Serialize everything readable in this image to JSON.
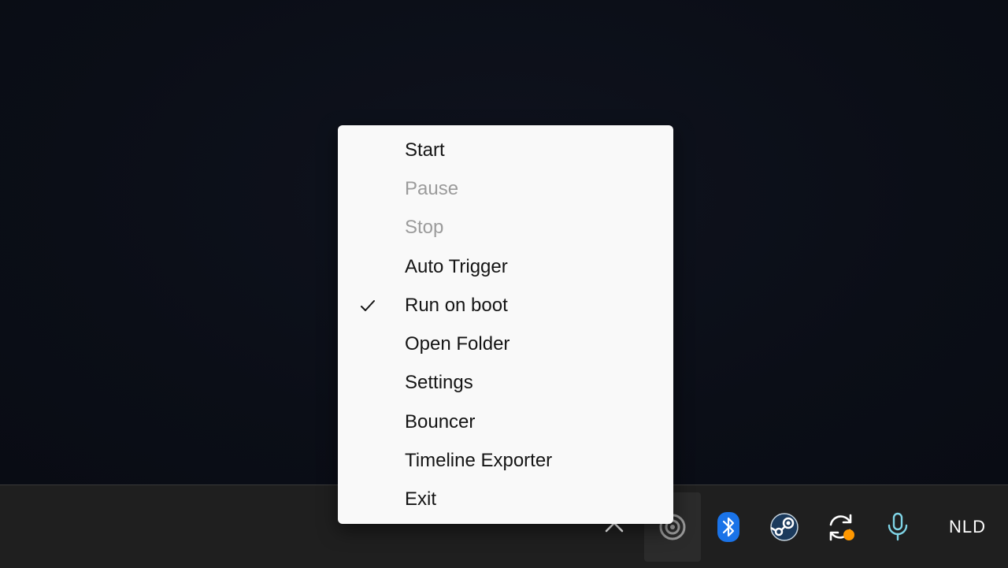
{
  "menu": {
    "items": [
      {
        "label": "Start",
        "enabled": true,
        "checked": false
      },
      {
        "label": "Pause",
        "enabled": false,
        "checked": false
      },
      {
        "label": "Stop",
        "enabled": false,
        "checked": false
      },
      {
        "label": "Auto Trigger",
        "enabled": true,
        "checked": false
      },
      {
        "label": "Run on boot",
        "enabled": true,
        "checked": true
      },
      {
        "label": "Open Folder",
        "enabled": true,
        "checked": false
      },
      {
        "label": "Settings",
        "enabled": true,
        "checked": false
      },
      {
        "label": "Bouncer",
        "enabled": true,
        "checked": false
      },
      {
        "label": "Timeline Exporter",
        "enabled": true,
        "checked": false
      },
      {
        "label": "Exit",
        "enabled": true,
        "checked": false
      }
    ]
  },
  "tray": {
    "icons": [
      {
        "name": "chevron-up-icon",
        "color": "#ffffff"
      },
      {
        "name": "record-app-icon",
        "color": "#9a9a9a"
      },
      {
        "name": "bluetooth-icon",
        "color": "#1a73e8"
      },
      {
        "name": "steam-icon",
        "color": "#1b2838"
      },
      {
        "name": "sync-icon",
        "color": "#ff9800"
      },
      {
        "name": "microphone-icon",
        "color": "#7fd4e6"
      }
    ],
    "language": "NLD"
  },
  "colors": {
    "menu_bg": "#f9f9f9",
    "disabled_text": "#9b9b9b",
    "taskbar_bg": "#1f1f1f",
    "desktop_bg": "#0c0f18"
  }
}
